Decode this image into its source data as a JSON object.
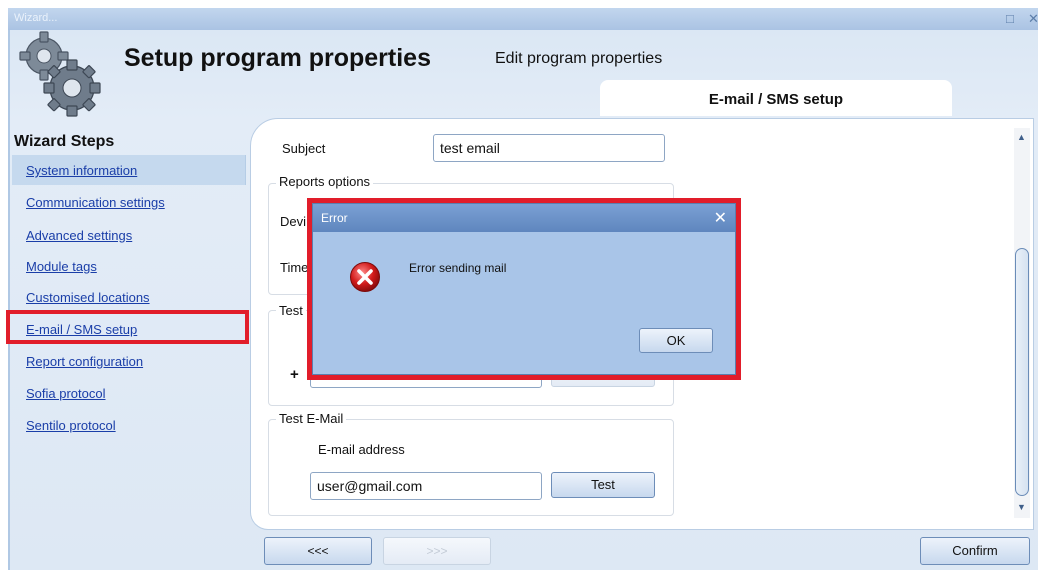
{
  "window": {
    "title": "Wizard...",
    "restore_icon": "□",
    "close_icon": "✕"
  },
  "header": {
    "title": "Setup program properties",
    "subtitle": "Edit program properties",
    "tab_label": "E-mail / SMS setup"
  },
  "sidebar": {
    "title": "Wizard Steps",
    "items": [
      {
        "label": "System information"
      },
      {
        "label": "Communication settings"
      },
      {
        "label": "Advanced settings"
      },
      {
        "label": "Module tags"
      },
      {
        "label": "Customised locations"
      },
      {
        "label": "E-mail / SMS setup"
      },
      {
        "label": "Report configuration"
      },
      {
        "label": "Sofia protocol"
      },
      {
        "label": "Sentilo protocol"
      }
    ],
    "selected_index": 0,
    "outlined_index": 5
  },
  "form": {
    "subject_label": "Subject",
    "subject_value": "test email",
    "reports_group_label": "Reports options",
    "device_label_partial": "Devi",
    "time_label_partial": "Time",
    "test_sms_group_label_partial": "Test",
    "plus_label": "+",
    "test_email_group_label": "Test E-Mail",
    "email_address_label": "E-mail address",
    "email_value": "user@gmail.com",
    "test_button": "Test"
  },
  "dialog": {
    "title": "Error",
    "message": "Error sending mail",
    "ok_button": "OK",
    "icon": "error-icon"
  },
  "navigation": {
    "back_button": "<<<",
    "next_button": ">>>",
    "confirm_button": "Confirm"
  },
  "colors": {
    "accent_blue": "#1a3ea8",
    "highlight_red": "#e11d2a",
    "dialog_bg": "#a9c5e8",
    "dialog_title_bg": "#6690c6"
  }
}
